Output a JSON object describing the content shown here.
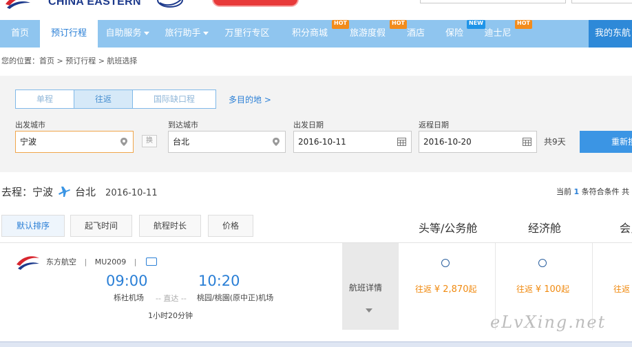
{
  "header": {
    "brand": "CHINA EASTERN"
  },
  "nav": {
    "items": [
      {
        "label": "首页"
      },
      {
        "label": "预订行程"
      },
      {
        "label": "自助服务"
      },
      {
        "label": "旅行助手"
      },
      {
        "label": "万里行专区"
      },
      {
        "label": "积分商城",
        "badge": "HOT"
      },
      {
        "label": "旅游度假",
        "badge": "HOT"
      },
      {
        "label": "酒店"
      },
      {
        "label": "保险",
        "badge": "NEW"
      },
      {
        "label": "迪士尼",
        "badge": "HOT"
      }
    ],
    "user": "我的东航"
  },
  "breadcrumb": "您的位置：首页 > 预订行程 > 航班选择",
  "search": {
    "trip_types": [
      "单程",
      "往返",
      "国际缺口程"
    ],
    "active_trip": "往返",
    "multi_destination": "多目的地 >",
    "from_label": "出发城市",
    "from_value": "宁波",
    "swap_label": "换",
    "to_label": "到达城市",
    "to_value": "台北",
    "depart_label": "出发日期",
    "depart_value": "2016-10-11",
    "return_label": "返程日期",
    "return_value": "2016-10-20",
    "total_days": "共9天",
    "research_button": "重新搜索"
  },
  "route": {
    "prefix": "去程：",
    "from": "宁波",
    "to": "台北",
    "date": "2016-10-11",
    "result_prefix": "当前",
    "result_count": "1",
    "result_suffix": "条符合条件 共"
  },
  "sort": {
    "buttons": [
      "默认排序",
      "起飞时间",
      "航程时长",
      "价格"
    ],
    "active": "默认排序"
  },
  "cabins": [
    "头等/公务舱",
    "经济舱",
    "会员"
  ],
  "flight": {
    "airline": "东方航空",
    "flight_no": "MU2009",
    "dep_time": "09:00",
    "arr_time": "10:20",
    "dep_airport": "栎社机场",
    "direct": "-- 直达 --",
    "arr_airport": "桃园/桃園(原中正)机场",
    "duration": "1小时20分钟",
    "detail_label": "航班详情",
    "fares": [
      {
        "prefix": "往返",
        "price": "¥ 2,870",
        "suffix": "起"
      },
      {
        "prefix": "往返",
        "price": "¥ 100",
        "suffix": "起"
      },
      {
        "prefix": "往返",
        "price": "",
        "suffix": ""
      }
    ]
  },
  "watermark": "eLvXing.net",
  "colors": {
    "nav_bg": "#8fc5ef",
    "accent": "#2a7fd6",
    "price": "#f08a10"
  }
}
